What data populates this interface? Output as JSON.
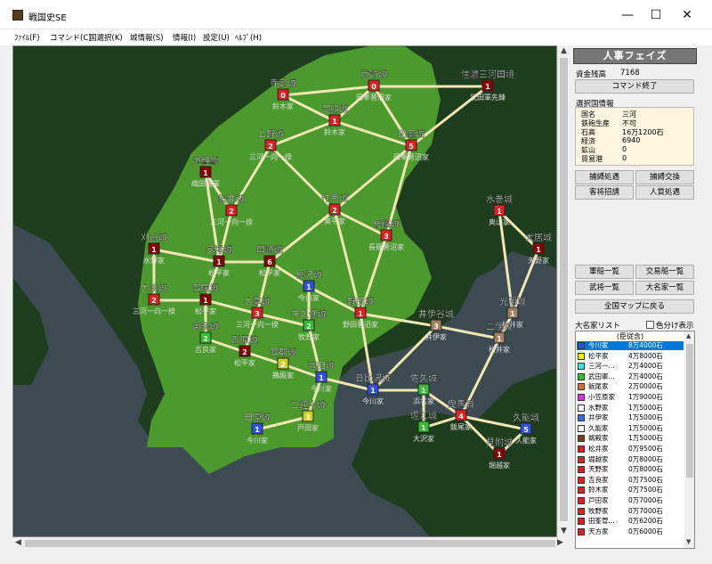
{
  "window": {
    "title": "戦国史SE",
    "minimize": "—",
    "maximize": "☐",
    "close": "✕"
  },
  "menu": [
    "ﾌｧｲﾙ(F)",
    "コマンド(C)",
    "国選択(K)",
    "城情報(S)",
    "情報(I)",
    "設定(U)",
    "ﾍﾙﾌﾟ(H)"
  ],
  "colors": {
    "sea": "#3c4a52",
    "land_dark": "#1e3d1e",
    "land_bright": "#4c9a2e",
    "road": "#f0e6b4",
    "label_bg": "#5f5f5f"
  },
  "map": {
    "castles": [
      {
        "name": "寺部城",
        "num": "0",
        "owner": "鈴木家",
        "color": "#e02020"
      },
      {
        "name": "武節城",
        "num": "0",
        "owner": "田峯菅沼家",
        "color": "#e02020"
      },
      {
        "name": "信濃三河国境",
        "num": "1",
        "owner": "武田軍先鋒",
        "color": "#8a0000"
      },
      {
        "name": "足助城",
        "num": "1",
        "owner": "鈴木家",
        "color": "#e02020"
      },
      {
        "name": "上野城",
        "num": "2",
        "owner": "三河一向一揆",
        "color": "#e02020"
      },
      {
        "name": "田峯城",
        "num": "5",
        "owner": "田峯菅沼家",
        "color": "#e02020"
      },
      {
        "name": "池鯉鮒",
        "num": "1",
        "owner": "織田援軍",
        "color": "#8a0000"
      },
      {
        "name": "桜井城",
        "num": "2",
        "owner": "三河一向一揆",
        "color": "#e02020"
      },
      {
        "name": "作手城",
        "num": "2",
        "owner": "奥平家",
        "color": "#e02020"
      },
      {
        "name": "長篠城",
        "num": "3",
        "owner": "長篠菅沼家",
        "color": "#e02020"
      },
      {
        "name": "刈谷城",
        "num": "1",
        "owner": "水野家",
        "color": "#8a0000"
      },
      {
        "name": "安祥城",
        "num": "1",
        "owner": "松平家",
        "color": "#8a0000"
      },
      {
        "name": "岡崎城",
        "num": "6",
        "owner": "松平家",
        "color": "#8a0000"
      },
      {
        "name": "長沢城",
        "num": "1",
        "owner": "今川家",
        "color": "#3050e0"
      },
      {
        "name": "大浜城",
        "num": "2",
        "owner": "三河一向一揆",
        "color": "#e02020"
      },
      {
        "name": "西尾城",
        "num": "1",
        "owner": "松平家",
        "color": "#8a0000"
      },
      {
        "name": "大草城",
        "num": "3",
        "owner": "三河一向一揆",
        "color": "#e02020"
      },
      {
        "name": "牛久保城",
        "num": "2",
        "owner": "牧野家",
        "color": "#30c030"
      },
      {
        "name": "野田城",
        "num": "1",
        "owner": "野田菅沼家",
        "color": "#e02020"
      },
      {
        "name": "井伊谷城",
        "num": "3",
        "owner": "井伊家",
        "color": "#a08060"
      },
      {
        "name": "東条城",
        "num": "2",
        "owner": "吉良家",
        "color": "#30c030"
      },
      {
        "name": "形原城",
        "num": "2",
        "owner": "松平家",
        "color": "#8a0000"
      },
      {
        "name": "西郡城",
        "num": "2",
        "owner": "鵜殿家",
        "color": "#d0d020"
      },
      {
        "name": "吉田城",
        "num": "1",
        "owner": "今川家",
        "color": "#3050e0"
      },
      {
        "name": "日比沢城",
        "num": "1",
        "owner": "今川家",
        "color": "#3050e0"
      },
      {
        "name": "佐久城",
        "num": "1",
        "owner": "浜名家",
        "color": "#30c030"
      },
      {
        "name": "二連木城",
        "num": "3",
        "owner": "戸田家",
        "color": "#d0d020"
      },
      {
        "name": "堀江城",
        "num": "1",
        "owner": "大沢家",
        "color": "#30c030"
      },
      {
        "name": "田原城",
        "num": "1",
        "owner": "今川家",
        "color": "#3050e0"
      },
      {
        "name": "曳馬城",
        "num": "4",
        "owner": "飯尾家",
        "color": "#e02020"
      },
      {
        "name": "久能城",
        "num": "5",
        "owner": "久能家",
        "color": "#3050e0"
      },
      {
        "name": "見附城",
        "num": "1",
        "owner": "堀越家",
        "color": "#8a0000"
      },
      {
        "name": "光明城",
        "num": "1",
        "owner": "松井家",
        "color": "#a08060"
      },
      {
        "name": "二俣城",
        "num": "1",
        "owner": "松井家",
        "color": "#a08060"
      },
      {
        "name": "水巻城",
        "num": "1",
        "owner": "奥山家",
        "color": "#e02020"
      },
      {
        "name": "犬居城",
        "num": "1",
        "owner": "天野家",
        "color": "#8a0000"
      }
    ]
  },
  "panel": {
    "phase": "人事フェイズ",
    "funds_label": "資金残高",
    "funds_value": "7168",
    "end_command": "コマンド終了",
    "info_title": "選択国情報",
    "info": [
      {
        "k": "国名",
        "v": "三河"
      },
      {
        "k": "鉄砲生産",
        "v": "不可"
      },
      {
        "k": "石高",
        "v": "16万1200石"
      },
      {
        "k": "経済",
        "v": "6940"
      },
      {
        "k": "鉱山",
        "v": "0"
      },
      {
        "k": "貿易港",
        "v": "0"
      }
    ],
    "buttons": {
      "capture": "捕縛処遇",
      "exchange": "捕縛交換",
      "guest": "客将招請",
      "hire": "人質処遇",
      "army_list": "軍船一覧",
      "trade_list": "交易船一覧",
      "generals": "武将一覧",
      "daimyo_list": "大名家一覧",
      "to_map": "全国マップに戻る"
    },
    "list_title": "大名家リスト",
    "color_toggle": "色分け表示",
    "list_head": "(臣従含)",
    "daimyo": [
      {
        "name": "今川家",
        "value": "8万4000石",
        "color": "#3050e0",
        "selected": true
      },
      {
        "name": "松平家",
        "value": "4万8000石",
        "color": "#f0f000"
      },
      {
        "name": "三河一...",
        "value": "2万4000石",
        "color": "#40e0e0"
      },
      {
        "name": "武田軍...",
        "value": "2万4000石",
        "color": "#30c030"
      },
      {
        "name": "飯尾家",
        "value": "2万0000石",
        "color": "#e07020"
      },
      {
        "name": "小笠原家",
        "value": "1万9000石",
        "color": "#e030e0"
      },
      {
        "name": "水野家",
        "value": "1万5000石",
        "color": "#ffffff"
      },
      {
        "name": "井伊家",
        "value": "1万5000石",
        "color": "#3070e0"
      },
      {
        "name": "久能家",
        "value": "1万5000石",
        "color": "#ffffff"
      },
      {
        "name": "鵜殿家",
        "value": "1万5000石",
        "color": "#7a4010"
      },
      {
        "name": "松井家",
        "value": "0万9500石",
        "color": "#e02020"
      },
      {
        "name": "堀越家",
        "value": "0万8000石",
        "color": "#e02020"
      },
      {
        "name": "天野家",
        "value": "0万8000石",
        "color": "#e02020"
      },
      {
        "name": "吉良家",
        "value": "0万7500石",
        "color": "#e02020"
      },
      {
        "name": "鈴木家",
        "value": "0万7500石",
        "color": "#e02020"
      },
      {
        "name": "戸田家",
        "value": "0万7000石",
        "color": "#e02020"
      },
      {
        "name": "牧野家",
        "value": "0万7000石",
        "color": "#e02020"
      },
      {
        "name": "田峯菅...",
        "value": "0万6200石",
        "color": "#e02020"
      },
      {
        "name": "天方家",
        "value": "0万6000石",
        "color": "#e02020"
      }
    ]
  }
}
